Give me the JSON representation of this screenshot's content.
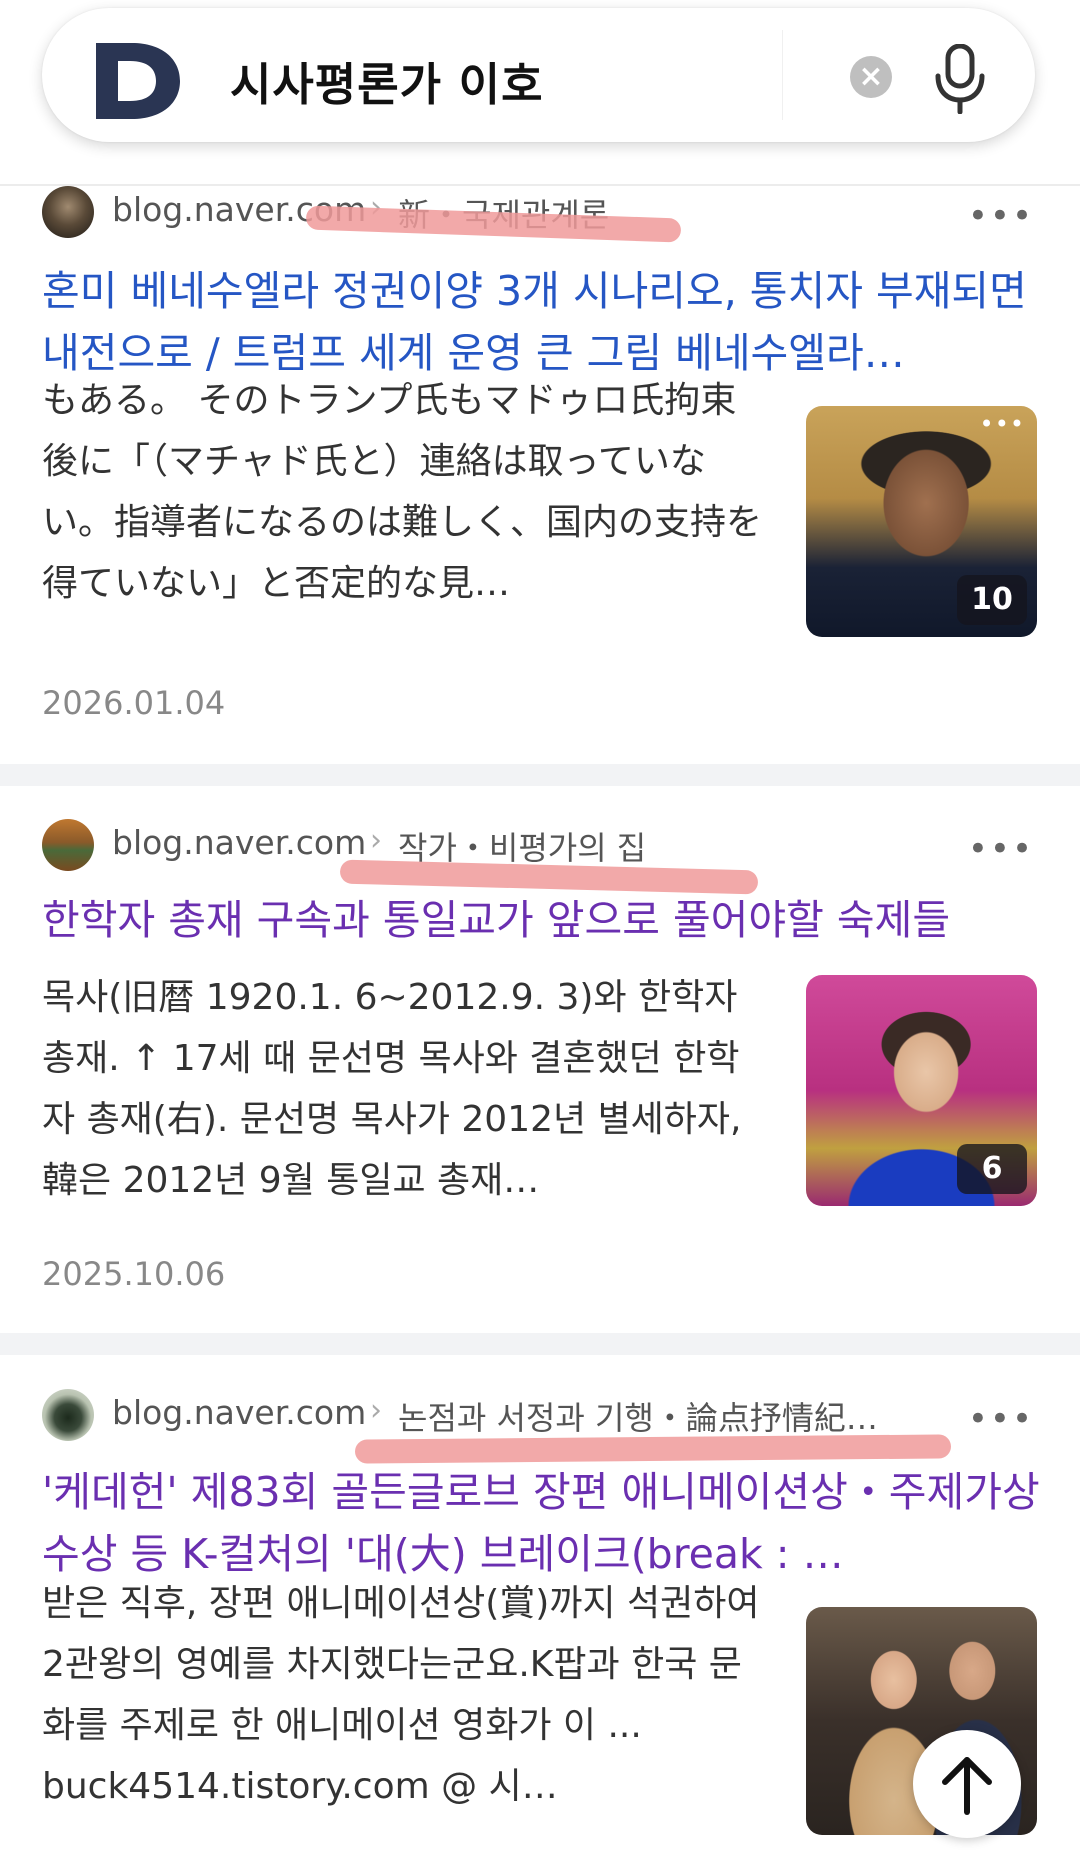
{
  "search": {
    "logo_letter": "D",
    "query": "시사평론가 이호",
    "clear_label": "×"
  },
  "results": [
    {
      "domain": "blog.naver.com",
      "chevron": "›",
      "path": "新・국제관계론",
      "more": "•••",
      "title": "혼미 베네수엘라 정권이양 3개 시나리오, 통치자 부재되면 내전으로 / 트럼프 세계 운영 큰 그림 베네수엘라…",
      "snippet": "もある。 そのトランプ氏もマドゥロ氏拘束後に「（マチャド氏と）連絡は取っていない。指導者になるのは難しく、国内の支持を得ていない」と否定的な見…",
      "image_count": "10",
      "thumb_dots": "•••",
      "date": "2026.01.04",
      "visited": false
    },
    {
      "domain": "blog.naver.com",
      "chevron": "›",
      "path": "작가・비평가의 집",
      "more": "•••",
      "title": "한학자 총재 구속과 통일교가 앞으로 풀어야할 숙제들",
      "snippet": "목사(旧暦 1920.1. 6~2012.9. 3)와 한학자 총재.  ↑ 17세 때 문선명 목사와 결혼했던 한학자 총재(右). 문선명 목사가 2012년 별세하자, 韓은 2012년 9월 통일교 총재…",
      "image_count": "6",
      "date": "2025.10.06",
      "visited": true
    },
    {
      "domain": "blog.naver.com",
      "chevron": "›",
      "path": "논점과 서정과 기행・論点抒情紀…",
      "more": "•••",
      "title": "'케데헌' 제83회 골든글로브 장편 애니메이션상・주제가상 수상 등 K-컬처의 '대(大) 브레이크(break : …",
      "snippet": "받은 직후, 장편 애니메이션상(賞)까지 석권하여 2관왕의 영예를 차지했다는군요.K팝과 한국 문화를 주제로 한 애니메이션 영화가 이 ... buck4514.tistory.com  @ 시…",
      "visited": true
    }
  ],
  "colors": {
    "link": "#2556c4",
    "visited": "#6a2fb0",
    "highlight": "#f09a9a",
    "logo": "#2a3553"
  }
}
